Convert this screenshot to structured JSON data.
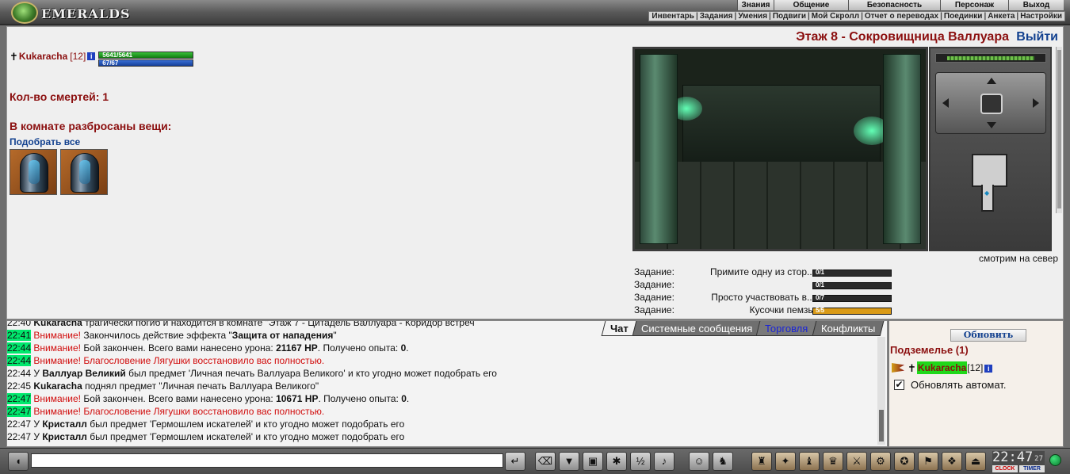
{
  "header": {
    "logo_text": "EMERALDS",
    "main_menu": [
      "Знания",
      "Общение",
      "Безопасность",
      "Персонаж",
      "Выход"
    ],
    "sub_menu": [
      "Инвентарь",
      "Задания",
      "Умения",
      "Подвиги",
      "Мой Скролл",
      "Отчет о переводах",
      "Поединки",
      "Анкета",
      "Настройки"
    ]
  },
  "player": {
    "name": "Kukaracha",
    "level": "[12]",
    "info": "i",
    "hp_text": "5641/5641",
    "hp_fraction": 1.0,
    "mp_text": "67/67",
    "mp_fraction": 1.0
  },
  "room": {
    "location": "Этаж 8 - Сокровищница Валлуара",
    "logout": "Выйти",
    "deaths": "Кол-во смертей: 1",
    "scattered_title": "В комнате разбросаны вещи:",
    "pickup_all": "Подобрать все",
    "facing": "смотрим на север"
  },
  "tasks": [
    {
      "label": "Задание:",
      "desc": "Примите одну из стор...",
      "progress": "0/1",
      "fraction": 0
    },
    {
      "label": "Задание:",
      "desc": "",
      "progress": "0/1",
      "fraction": 0
    },
    {
      "label": "Задание:",
      "desc": "Просто участвовать в...",
      "progress": "0/7",
      "fraction": 0
    },
    {
      "label": "Задание:",
      "desc": "Кусочки пемзы",
      "progress": "5/5",
      "fraction": 1
    }
  ],
  "chat": {
    "tabs": [
      "Чат",
      "Системные сообщения",
      "Торговля",
      "Конфликты"
    ],
    "lines": [
      {
        "time": "22:40",
        "parts": [
          {
            "t": "Kukaracha",
            "c": "b"
          },
          {
            "t": " трагически погиб и находится в комнате \"Этаж 7 - Цитадель Валлуара - Коридор встреч",
            "c": ""
          }
        ]
      },
      {
        "time": "22:41",
        "hl": true,
        "parts": [
          {
            "t": "Внимание!",
            "c": "warn"
          },
          {
            "t": " Закончилось действие эффекта \"",
            "c": ""
          },
          {
            "t": "Защита от нападения",
            "c": "b"
          },
          {
            "t": "\"",
            "c": ""
          }
        ]
      },
      {
        "time": "22:44",
        "hl": true,
        "parts": [
          {
            "t": "Внимание!",
            "c": "warn"
          },
          {
            "t": " Бой закончен. Всего вами нанесено урона: ",
            "c": ""
          },
          {
            "t": "21167 HP",
            "c": "b"
          },
          {
            "t": ". Получено опыта: ",
            "c": ""
          },
          {
            "t": "0",
            "c": "b"
          },
          {
            "t": ".",
            "c": ""
          }
        ]
      },
      {
        "time": "22:44",
        "hl": true,
        "parts": [
          {
            "t": "Внимание!",
            "c": "warn"
          },
          {
            "t": " Благословение Лягушки восстановило вас полностью.",
            "c": "red"
          }
        ]
      },
      {
        "time": "22:44",
        "parts": [
          {
            "t": "У ",
            "c": ""
          },
          {
            "t": "Валлуар Великий",
            "c": "b"
          },
          {
            "t": " был предмет 'Личная печать Валлуара Великого' и кто угодно может подобрать его",
            "c": ""
          }
        ]
      },
      {
        "time": "22:45",
        "parts": [
          {
            "t": "Kukaracha",
            "c": "b"
          },
          {
            "t": " поднял предмет \"Личная печать Валлуара Великого\"",
            "c": ""
          }
        ]
      },
      {
        "time": "22:47",
        "hl": true,
        "parts": [
          {
            "t": "Внимание!",
            "c": "warn"
          },
          {
            "t": " Бой закончен. Всего вами нанесено урона: ",
            "c": ""
          },
          {
            "t": "10671 HP",
            "c": "b"
          },
          {
            "t": ". Получено опыта: ",
            "c": ""
          },
          {
            "t": "0",
            "c": "b"
          },
          {
            "t": ".",
            "c": ""
          }
        ]
      },
      {
        "time": "22:47",
        "hl": true,
        "parts": [
          {
            "t": "Внимание!",
            "c": "warn"
          },
          {
            "t": " Благословение Лягушки восстановило вас полностью.",
            "c": "red"
          }
        ]
      },
      {
        "time": "22:47",
        "parts": [
          {
            "t": "У ",
            "c": ""
          },
          {
            "t": "Кристалл",
            "c": "b"
          },
          {
            "t": " был предмет 'Гермошлем искателей' и кто угодно может подобрать его",
            "c": ""
          }
        ]
      },
      {
        "time": "22:47",
        "parts": [
          {
            "t": "У ",
            "c": ""
          },
          {
            "t": "Кристалл",
            "c": "b"
          },
          {
            "t": " был предмет 'Гермошлем искателей' и кто угодно может подобрать его",
            "c": ""
          }
        ]
      }
    ]
  },
  "side": {
    "refresh": "Обновить",
    "dungeon": "Подземелье (1)",
    "member_name": "Kukaracha",
    "member_level": "[12]",
    "auto_refresh": "Обновлять автомат.",
    "auto_checked": "✔"
  },
  "clock": {
    "time": "22:47",
    "seconds": "27",
    "clock_label": "CLOCK",
    "timer_label": "TIMER"
  },
  "toolbar": {
    "icons": [
      "speaker-icon",
      "enter-icon",
      "eraser-icon",
      "filter-icon",
      "save-icon",
      "dance-icon",
      "ratio-icon",
      "audio-icon",
      "smile-icon",
      "helmet-icon",
      "action-1-icon",
      "action-2-icon",
      "action-3-icon",
      "action-4-icon",
      "action-5-icon",
      "action-6-icon",
      "action-7-icon",
      "action-8-icon",
      "action-9-icon",
      "exit-icon"
    ]
  }
}
